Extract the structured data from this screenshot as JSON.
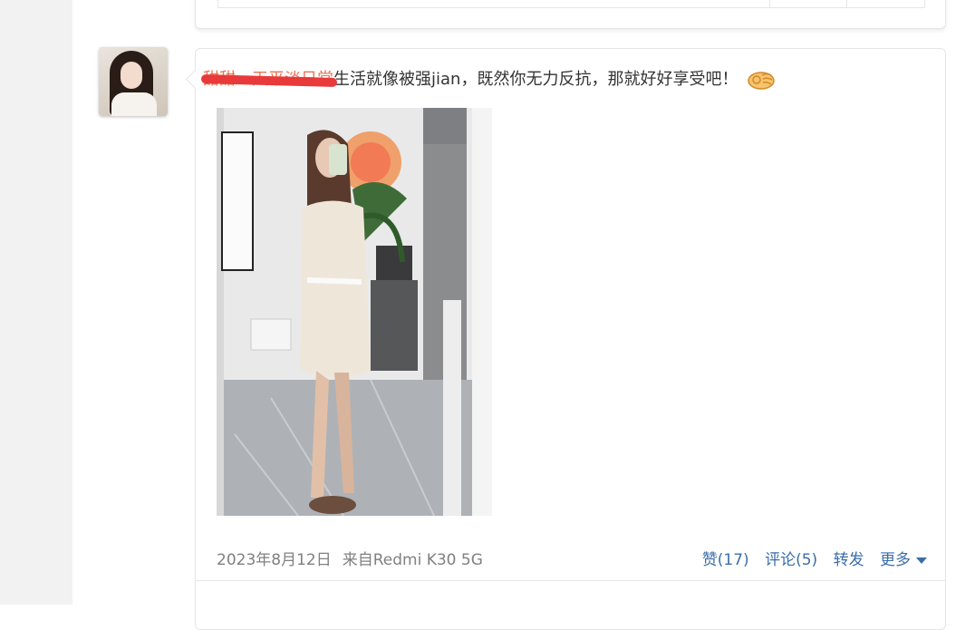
{
  "post": {
    "author": "甜甜一天平淡日常",
    "text": "生活就像被强jian，既然你无力反抗，那就好好享受吧！",
    "emoji_icon": "ok-hand-icon",
    "date": "2023年8月12日",
    "source": "来自Redmi K30 5G"
  },
  "actions": {
    "like": "赞(17)",
    "comment": "评论(5)",
    "repost": "转发",
    "more": "更多"
  },
  "colors": {
    "link": "#3b6ea8",
    "author": "#eb7350",
    "redaction": "#e83a3a",
    "meta_text": "#808080",
    "gutter": "#f2f2f2"
  }
}
